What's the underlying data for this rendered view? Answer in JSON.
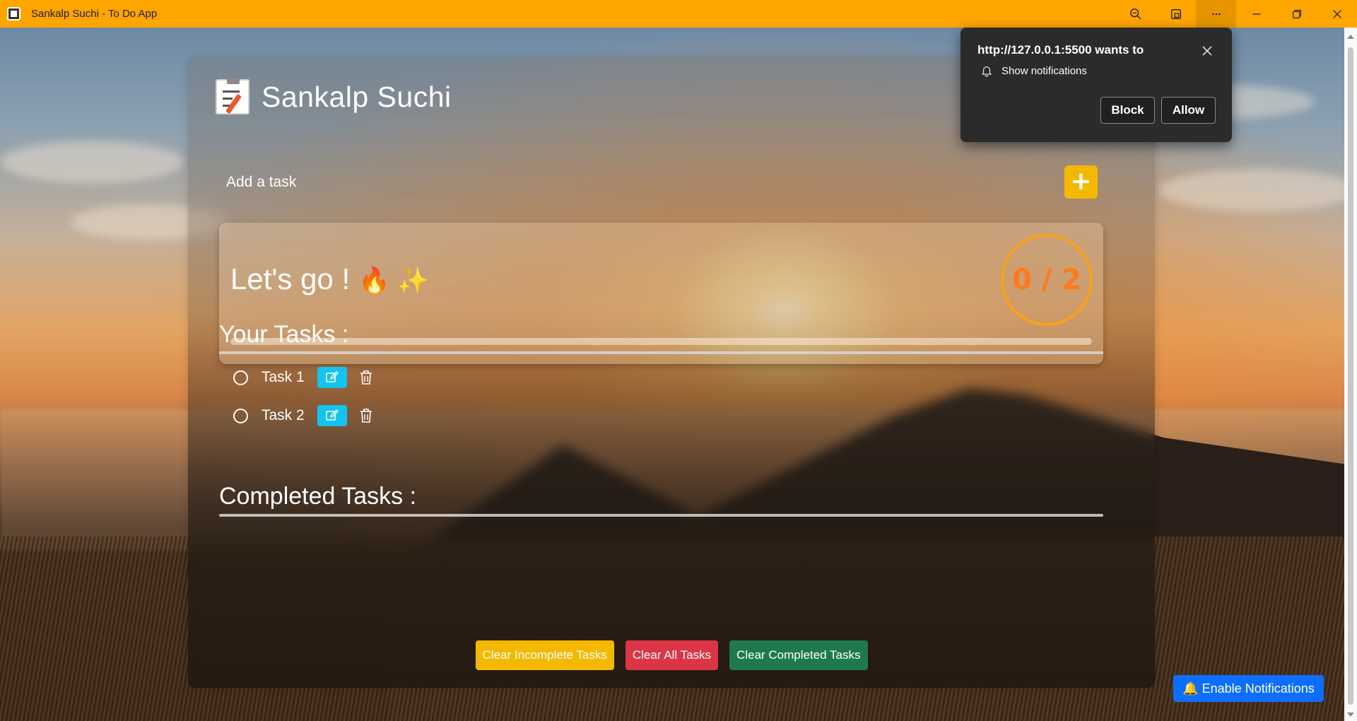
{
  "window": {
    "title": "Sankalp Suchi - To Do App",
    "accent_color": "#ffa500"
  },
  "app": {
    "brand_title": "Sankalp Suchi",
    "brand_icon": "memo-icon",
    "add_task_placeholder": "Add a task",
    "add_button_label": "+",
    "motto": "Let's go !",
    "motto_emoji": "🔥 ✨",
    "progress_label": "0 / 2",
    "progress_fraction": 0,
    "your_tasks_heading": "Your Tasks :",
    "completed_tasks_heading": "Completed Tasks :",
    "tasks": [
      {
        "name": "Task 1",
        "completed": false
      },
      {
        "name": "Task 2",
        "completed": false
      }
    ],
    "actions": {
      "clear_incomplete": "Clear Incomplete Tasks",
      "clear_all": "Clear All Tasks",
      "clear_completed": "Clear Completed Tasks"
    },
    "enable_notifications": "🔔 Enable Notifications"
  },
  "notification_prompt": {
    "title": "http://127.0.0.1:5500 wants to",
    "permission": "Show notifications",
    "block_label": "Block",
    "allow_label": "Allow"
  },
  "colors": {
    "add_button": "#f5b800",
    "edit_button": "#14c3f0",
    "clear_incomplete": "#f5b800",
    "clear_all": "#dc3545",
    "clear_completed": "#1e7a4c",
    "enable_notifications": "#0d6efd",
    "progress_ring": "#f7a21b"
  }
}
